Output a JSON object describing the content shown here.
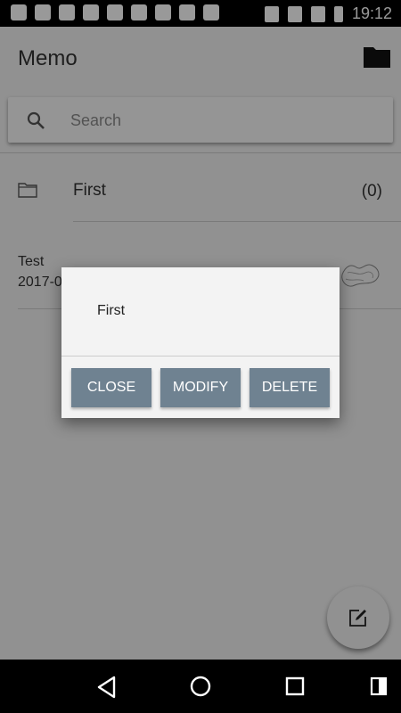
{
  "status_bar": {
    "time": "19:12",
    "left_icons": [
      "note-icon",
      "image-icon",
      "ridi-icon",
      "ridi-icon",
      "gmail-icon",
      "vpn-icon",
      "app-icon",
      "android-icon",
      "check-icon"
    ],
    "right_icons": [
      "vibrate-icon",
      "data-icon",
      "signal-icon",
      "battery-icon"
    ]
  },
  "app_bar": {
    "title": "Memo",
    "folder_icon": "folder-icon"
  },
  "search": {
    "placeholder": "Search",
    "icon": "search-icon"
  },
  "list": {
    "folders": [
      {
        "name": "First",
        "count": "(0)"
      }
    ],
    "memos": [
      {
        "title": "Test",
        "date": "2017-0"
      }
    ]
  },
  "dialog": {
    "message": "First",
    "buttons": {
      "close": "CLOSE",
      "modify": "MODIFY",
      "delete": "DELETE"
    }
  },
  "fab": {
    "icon": "edit-icon"
  },
  "nav_bar": {
    "icons": [
      "back-icon",
      "home-icon",
      "recent-apps-icon",
      "switch-icon"
    ]
  },
  "colors": {
    "background": "#f2f2f2",
    "dialog_button": "#6f8291",
    "scrim": "#000000"
  }
}
